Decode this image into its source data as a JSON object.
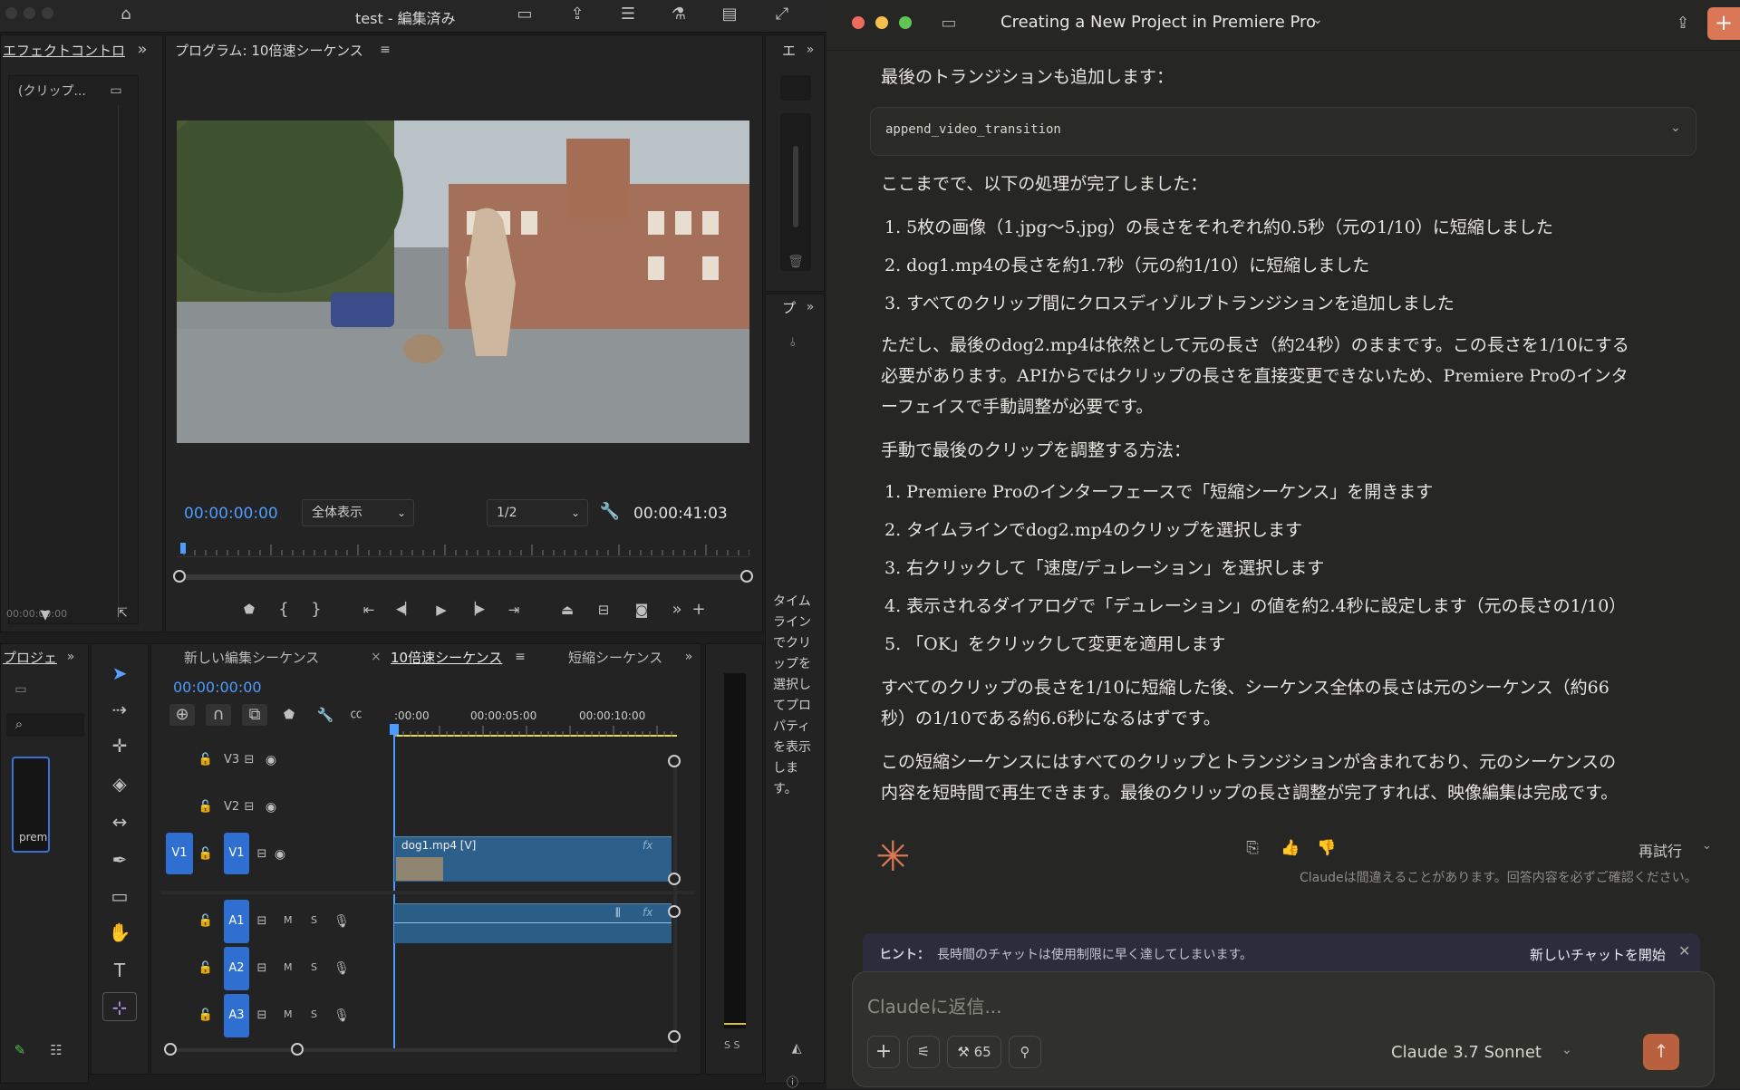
{
  "premiere": {
    "window_title": "test - 編集済み",
    "effects_panel": {
      "title": "エフェクトコントロ",
      "clip_label": "(クリップ...",
      "timecode": "00:00:00:00"
    },
    "program_monitor": {
      "title": "プログラム: 10倍速シーケンス",
      "timecode": "00:00:00:00",
      "zoom": "全体表示",
      "resolution": "1/2",
      "duration": "00:00:41:03"
    },
    "right_panel": {
      "title_top": "エ",
      "title_bottom": "プ",
      "hint_text": "タイムラインでクリップを選択してプロパティを表示します。"
    },
    "project_panel": {
      "title": "プロジェ",
      "thumb_label": "prem"
    },
    "timeline": {
      "tabs": [
        {
          "label": "新しい編集シーケンス"
        },
        {
          "label": "10倍速シーケンス"
        },
        {
          "label": "短縮シーケンス"
        }
      ],
      "close_glyph": "×",
      "timecode": "00:00:00:00",
      "ruler": [
        ":00:00",
        "00:00:05:00",
        "00:00:10:00"
      ],
      "video_tracks": [
        {
          "name": "V3"
        },
        {
          "name": "V2"
        },
        {
          "name": "V1",
          "source": "V1"
        }
      ],
      "audio_tracks": [
        {
          "name": "A1",
          "m": "M",
          "s": "S"
        },
        {
          "name": "A2",
          "m": "M",
          "s": "S"
        },
        {
          "name": "A3",
          "m": "M",
          "s": "S"
        }
      ],
      "clip_label": "dog1.mp4 [V]",
      "fx": "fx"
    },
    "meter": {
      "labels": "S S"
    }
  },
  "claude": {
    "conversation_title": "Creating a New Project in Premiere Pro",
    "intro": "最後のトランジションも追加します：",
    "tool_call": "append_video_transition",
    "done_header": "ここまでで、以下の処理が完了しました：",
    "done_items": [
      "1. 5枚の画像（1.jpg〜5.jpg）の長さをそれぞれ約0.5秒（元の1/10）に短縮しました",
      "2. dog1.mp4の長さを約1.7秒（元の約1/10）に短縮しました",
      "3. すべてのクリップ間にクロスディゾルブトランジションを追加しました"
    ],
    "note_line1": "ただし、最後のdog2.mp4は依然として元の長さ（約24秒）のままです。この長さを1/10にする",
    "note_line2": "必要があります。APIからではクリップの長さを直接変更できないため、Premiere Proのインタ",
    "note_line3": "ーフェイスで手動調整が必要です。",
    "manual_header": "手動で最後のクリップを調整する方法：",
    "manual_items": [
      "1. Premiere Proのインターフェースで「短縮シーケンス」を開きます",
      "2. タイムラインでdog2.mp4のクリップを選択します",
      "3. 右クリックして「速度/デュレーション」を選択します",
      "4. 表示されるダイアログで「デュレーション」の値を約2.4秒に設定します（元の長さの1/10）",
      "5. 「OK」をクリックして変更を適用します"
    ],
    "summary_line1": "すべてのクリップの長さを1/10に短縮した後、シーケンス全体の長さは元のシーケンス（約66",
    "summary_line2": "秒）の1/10である約6.6秒になるはずです。",
    "closing_line1": "この短縮シーケンスにはすべてのクリップとトランジションが含まれており、元のシーケンスの",
    "closing_line2": "内容を短時間で再生できます。最後のクリップの長さ調整が完了すれば、映像編集は完成です。",
    "retry": "再試行",
    "disclaimer": "Claudeは間違えることがあります。回答内容を必ずご確認ください。",
    "hint_label": "ヒント：",
    "hint_text": "長時間のチャットは使用制限に早く達してしまいます。",
    "new_chat": "新しいチャットを開始",
    "input_placeholder": "Claudeに返信...",
    "tools_count": "65",
    "model": "Claude 3.7 Sonnet",
    "accent": "#d97757"
  }
}
